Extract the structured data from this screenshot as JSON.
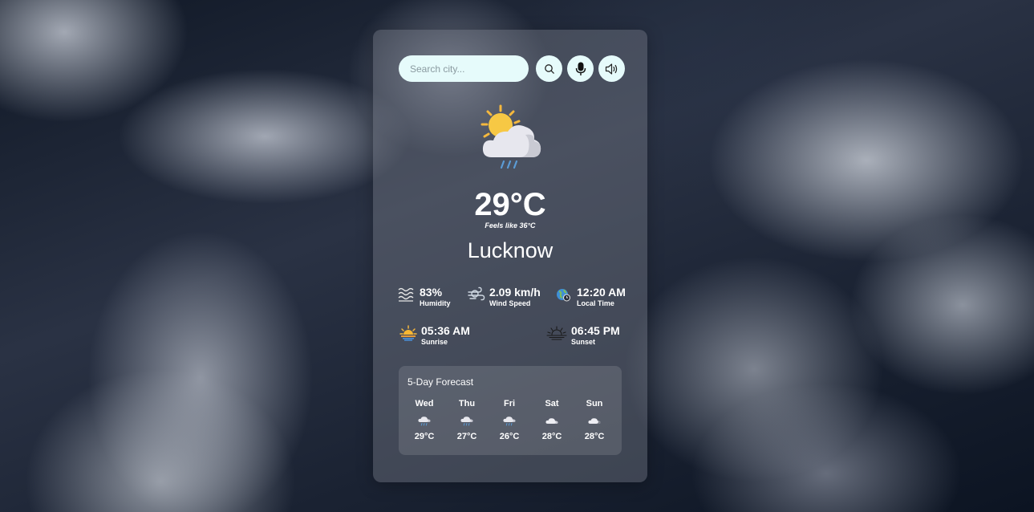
{
  "search": {
    "placeholder": "Search city..."
  },
  "current": {
    "temperature": "29°C",
    "feels_like": "Feels like 36°C",
    "city": "Lucknow",
    "icon": "sun-cloud-rain-icon"
  },
  "stats": {
    "humidity": {
      "value": "83%",
      "label": "Humidity",
      "icon": "humidity-icon"
    },
    "wind": {
      "value": "2.09 km/h",
      "label": "Wind Speed",
      "icon": "wind-icon"
    },
    "local_time": {
      "value": "12:20 AM",
      "label": "Local Time",
      "icon": "globe-clock-icon"
    },
    "sunrise": {
      "value": "05:36 AM",
      "label": "Sunrise",
      "icon": "sunrise-icon"
    },
    "sunset": {
      "value": "06:45 PM",
      "label": "Sunset",
      "icon": "sunset-icon"
    }
  },
  "forecast": {
    "title": "5-Day Forecast",
    "days": [
      {
        "name": "Wed",
        "temp": "29°C",
        "icon": "rain-cloud-icon"
      },
      {
        "name": "Thu",
        "temp": "27°C",
        "icon": "rain-cloud-icon"
      },
      {
        "name": "Fri",
        "temp": "26°C",
        "icon": "rain-cloud-icon"
      },
      {
        "name": "Sat",
        "temp": "28°C",
        "icon": "cloud-icon"
      },
      {
        "name": "Sun",
        "temp": "28°C",
        "icon": "cloud-icon"
      }
    ]
  },
  "colors": {
    "input_bg": "#e6fbfb",
    "sun": "#f5c242",
    "cloud": "#e8e8ee",
    "rain": "#5b9bd5"
  }
}
